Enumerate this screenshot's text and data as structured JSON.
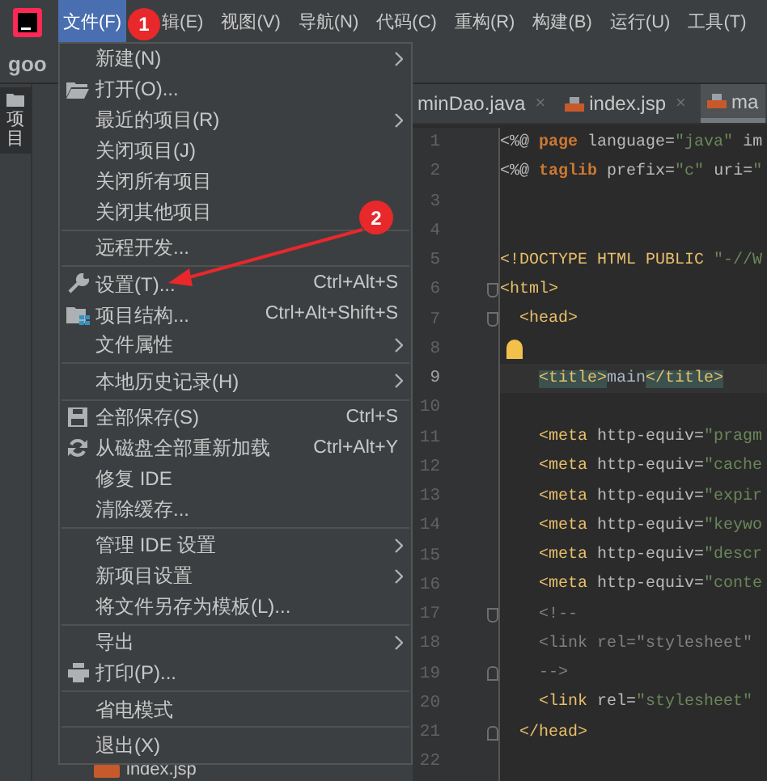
{
  "menubar": [
    {
      "label": "文件(F)",
      "selected": true
    },
    {
      "label": "辑(E)",
      "selected": false
    },
    {
      "label": "视图(V)",
      "selected": false
    },
    {
      "label": "导航(N)",
      "selected": false
    },
    {
      "label": "代码(C)",
      "selected": false
    },
    {
      "label": "重构(R)",
      "selected": false
    },
    {
      "label": "构建(B)",
      "selected": false
    },
    {
      "label": "运行(U)",
      "selected": false
    },
    {
      "label": "工具(T)",
      "selected": false
    }
  ],
  "toolbar": {
    "project_name": "goo"
  },
  "tool_strip": {
    "label": "项目"
  },
  "project_tree": {
    "items": [
      {
        "label": "index.jsp"
      }
    ]
  },
  "editor_tabs": [
    {
      "label": "minDao.java",
      "kind": "java",
      "close": "×",
      "selected": false
    },
    {
      "label": "index.jsp",
      "kind": "jsp",
      "close": "×",
      "selected": false
    },
    {
      "label": "ma",
      "kind": "jsp",
      "selected": true
    }
  ],
  "file_menu": {
    "groups": [
      [
        {
          "label": "新建(N)",
          "submenu": true
        },
        {
          "label": "打开(O)...",
          "submenu": false
        },
        {
          "label": "最近的项目(R)",
          "submenu": true
        },
        {
          "label": "关闭项目(J)",
          "submenu": false
        },
        {
          "label": "关闭所有项目",
          "submenu": false
        },
        {
          "label": "关闭其他项目",
          "submenu": false
        }
      ],
      [
        {
          "label": "远程开发...",
          "submenu": false
        }
      ],
      [
        {
          "label": "设置(T)...",
          "shortcut": "Ctrl+Alt+S",
          "submenu": false
        },
        {
          "label": "项目结构...",
          "shortcut": "Ctrl+Alt+Shift+S",
          "submenu": false
        },
        {
          "label": "文件属性",
          "submenu": true
        }
      ],
      [
        {
          "label": "本地历史记录(H)",
          "submenu": true
        }
      ],
      [
        {
          "label": "全部保存(S)",
          "shortcut": "Ctrl+S",
          "submenu": false
        },
        {
          "label": "从磁盘全部重新加载",
          "shortcut": "Ctrl+Alt+Y",
          "submenu": false
        },
        {
          "label": "修复 IDE",
          "submenu": false
        },
        {
          "label": "清除缓存...",
          "submenu": false
        }
      ],
      [
        {
          "label": "管理 IDE 设置",
          "submenu": true
        },
        {
          "label": "新项目设置",
          "submenu": true
        },
        {
          "label": "将文件另存为模板(L)...",
          "submenu": false
        }
      ],
      [
        {
          "label": "导出",
          "submenu": true
        },
        {
          "label": "打印(P)...",
          "submenu": false
        }
      ],
      [
        {
          "label": "省电模式",
          "submenu": false
        }
      ],
      [
        {
          "label": "退出(X)",
          "submenu": false
        }
      ]
    ]
  },
  "code_lines": [
    {
      "number": "1",
      "current": false,
      "fold_start": false,
      "fold_end": false,
      "bulb": false,
      "segments": [
        {
          "kind": "directive",
          "text": "<%@ "
        },
        {
          "kind": "keyword",
          "text": "page "
        },
        {
          "kind": "attr",
          "text": "language="
        },
        {
          "kind": "string",
          "text": "\"java\" "
        },
        {
          "kind": "attr",
          "text": "im"
        }
      ]
    },
    {
      "number": "2",
      "current": false,
      "fold_start": false,
      "fold_end": false,
      "bulb": false,
      "segments": [
        {
          "kind": "directive",
          "text": "<%@ "
        },
        {
          "kind": "keyword",
          "text": "taglib "
        },
        {
          "kind": "attr",
          "text": "prefix="
        },
        {
          "kind": "string",
          "text": "\"c\" "
        },
        {
          "kind": "attr",
          "text": "uri="
        },
        {
          "kind": "string",
          "text": "\""
        }
      ]
    },
    {
      "number": "3",
      "current": false,
      "fold_start": false,
      "fold_end": false,
      "bulb": false
    },
    {
      "number": "4",
      "current": false,
      "fold_start": false,
      "fold_end": false,
      "bulb": false
    },
    {
      "number": "5",
      "current": false,
      "fold_start": false,
      "fold_end": false,
      "bulb": false,
      "segments": [
        {
          "kind": "tag",
          "text": "<!DOCTYPE HTML PUBLIC "
        },
        {
          "kind": "string",
          "text": "\"-//W"
        }
      ]
    },
    {
      "number": "6",
      "current": false,
      "fold_start": true,
      "fold_end": false,
      "bulb": false,
      "segments": [
        {
          "kind": "tag",
          "text": "<html>"
        }
      ]
    },
    {
      "number": "7",
      "current": false,
      "fold_start": true,
      "fold_end": false,
      "bulb": false,
      "segments": [
        {
          "kind": "tag",
          "text": "  <head>"
        }
      ]
    },
    {
      "number": "8",
      "current": false,
      "fold_start": false,
      "fold_end": false,
      "bulb": true
    },
    {
      "number": "9",
      "current": true,
      "fold_start": false,
      "fold_end": false,
      "bulb": false,
      "segments": [
        {
          "kind": "matched_tag",
          "text": "    <title>"
        },
        {
          "kind": "plain",
          "text": "main"
        },
        {
          "kind": "matched_tag",
          "text": "</title>"
        }
      ]
    },
    {
      "number": "10",
      "current": false,
      "fold_start": false,
      "fold_end": false,
      "bulb": false
    },
    {
      "number": "11",
      "current": false,
      "fold_start": false,
      "fold_end": false,
      "bulb": false,
      "segments": [
        {
          "kind": "tag",
          "text": "    <meta "
        },
        {
          "kind": "attr",
          "text": "http-equiv="
        },
        {
          "kind": "string",
          "text": "\"pragm"
        }
      ]
    },
    {
      "number": "12",
      "current": false,
      "fold_start": false,
      "fold_end": false,
      "bulb": false,
      "segments": [
        {
          "kind": "tag",
          "text": "    <meta "
        },
        {
          "kind": "attr",
          "text": "http-equiv="
        },
        {
          "kind": "string",
          "text": "\"cache"
        }
      ]
    },
    {
      "number": "13",
      "current": false,
      "fold_start": false,
      "fold_end": false,
      "bulb": false,
      "segments": [
        {
          "kind": "tag",
          "text": "    <meta "
        },
        {
          "kind": "attr",
          "text": "http-equiv="
        },
        {
          "kind": "string",
          "text": "\"expir"
        }
      ]
    },
    {
      "number": "14",
      "current": false,
      "fold_start": false,
      "fold_end": false,
      "bulb": false,
      "segments": [
        {
          "kind": "tag",
          "text": "    <meta "
        },
        {
          "kind": "attr",
          "text": "http-equiv="
        },
        {
          "kind": "string",
          "text": "\"keywo"
        }
      ]
    },
    {
      "number": "15",
      "current": false,
      "fold_start": false,
      "fold_end": false,
      "bulb": false,
      "segments": [
        {
          "kind": "tag",
          "text": "    <meta "
        },
        {
          "kind": "attr",
          "text": "http-equiv="
        },
        {
          "kind": "string",
          "text": "\"descr"
        }
      ]
    },
    {
      "number": "16",
      "current": false,
      "fold_start": false,
      "fold_end": false,
      "bulb": false,
      "segments": [
        {
          "kind": "tag",
          "text": "    <meta "
        },
        {
          "kind": "attr",
          "text": "http-equiv="
        },
        {
          "kind": "string",
          "text": "\"conte"
        }
      ]
    },
    {
      "number": "17",
      "current": false,
      "fold_start": true,
      "fold_end": false,
      "bulb": false,
      "segments": [
        {
          "kind": "comment",
          "text": "    <!--"
        }
      ]
    },
    {
      "number": "18",
      "current": false,
      "fold_start": false,
      "fold_end": false,
      "bulb": false,
      "segments": [
        {
          "kind": "comment",
          "text": "    <link rel=\"stylesheet\""
        }
      ]
    },
    {
      "number": "19",
      "current": false,
      "fold_start": false,
      "fold_end": true,
      "bulb": false,
      "segments": [
        {
          "kind": "comment",
          "text": "    -->"
        }
      ]
    },
    {
      "number": "20",
      "current": false,
      "fold_start": false,
      "fold_end": false,
      "bulb": false,
      "segments": [
        {
          "kind": "tag",
          "text": "    <link "
        },
        {
          "kind": "attr",
          "text": "rel="
        },
        {
          "kind": "string",
          "text": "\"stylesheet\""
        }
      ]
    },
    {
      "number": "21",
      "current": false,
      "fold_start": false,
      "fold_end": true,
      "bulb": false,
      "segments": [
        {
          "kind": "tag",
          "text": "  </head>"
        }
      ]
    },
    {
      "number": "22",
      "current": false,
      "fold_start": false,
      "fold_end": false,
      "bulb": false
    }
  ],
  "annotations": [
    {
      "label": "1"
    },
    {
      "label": "2"
    }
  ]
}
